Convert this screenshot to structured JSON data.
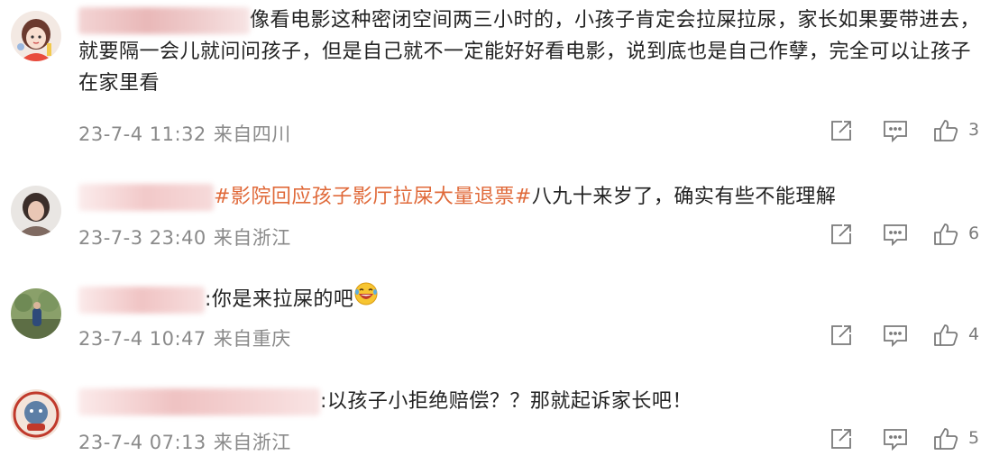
{
  "comments": [
    {
      "text": "像看电影这种密闭空间两三小时的，小孩子肯定会拉屎拉尿，家长如果要带进去，就要隔一会儿就问问孩子，但是自己就不一定能好好看电影，说到底也是自己作孽，完全可以让孩子在家里看",
      "date": "23-7-4 11:32",
      "location": "来自四川",
      "likes": "3",
      "avatar_icon": "girl-cartoon-avatar-icon"
    },
    {
      "topic": "#影院回应孩子影厅拉屎大量退票#",
      "text": "八九十来岁了，确实有些不能理解",
      "date": "23-7-3 23:40",
      "location": "来自浙江",
      "likes": "6",
      "avatar_icon": "woman-photo-avatar-icon"
    },
    {
      "text": ":你是来拉屎的吧",
      "emoji": "laughing-crying-emoji",
      "date": "23-7-4 10:47",
      "location": "来自重庆",
      "likes": "4",
      "avatar_icon": "outdoor-photo-avatar-icon"
    },
    {
      "text": ":以孩子小拒绝赔偿？？那就起诉家长吧！",
      "date": "23-7-4 07:13",
      "location": "来自浙江",
      "likes": "5",
      "avatar_icon": "cartoon-stamp-avatar-icon"
    }
  ],
  "colors": {
    "text": "#222222",
    "meta": "#8a8a8a",
    "topic": "#e06a3a",
    "icon": "#7a7a7a"
  }
}
